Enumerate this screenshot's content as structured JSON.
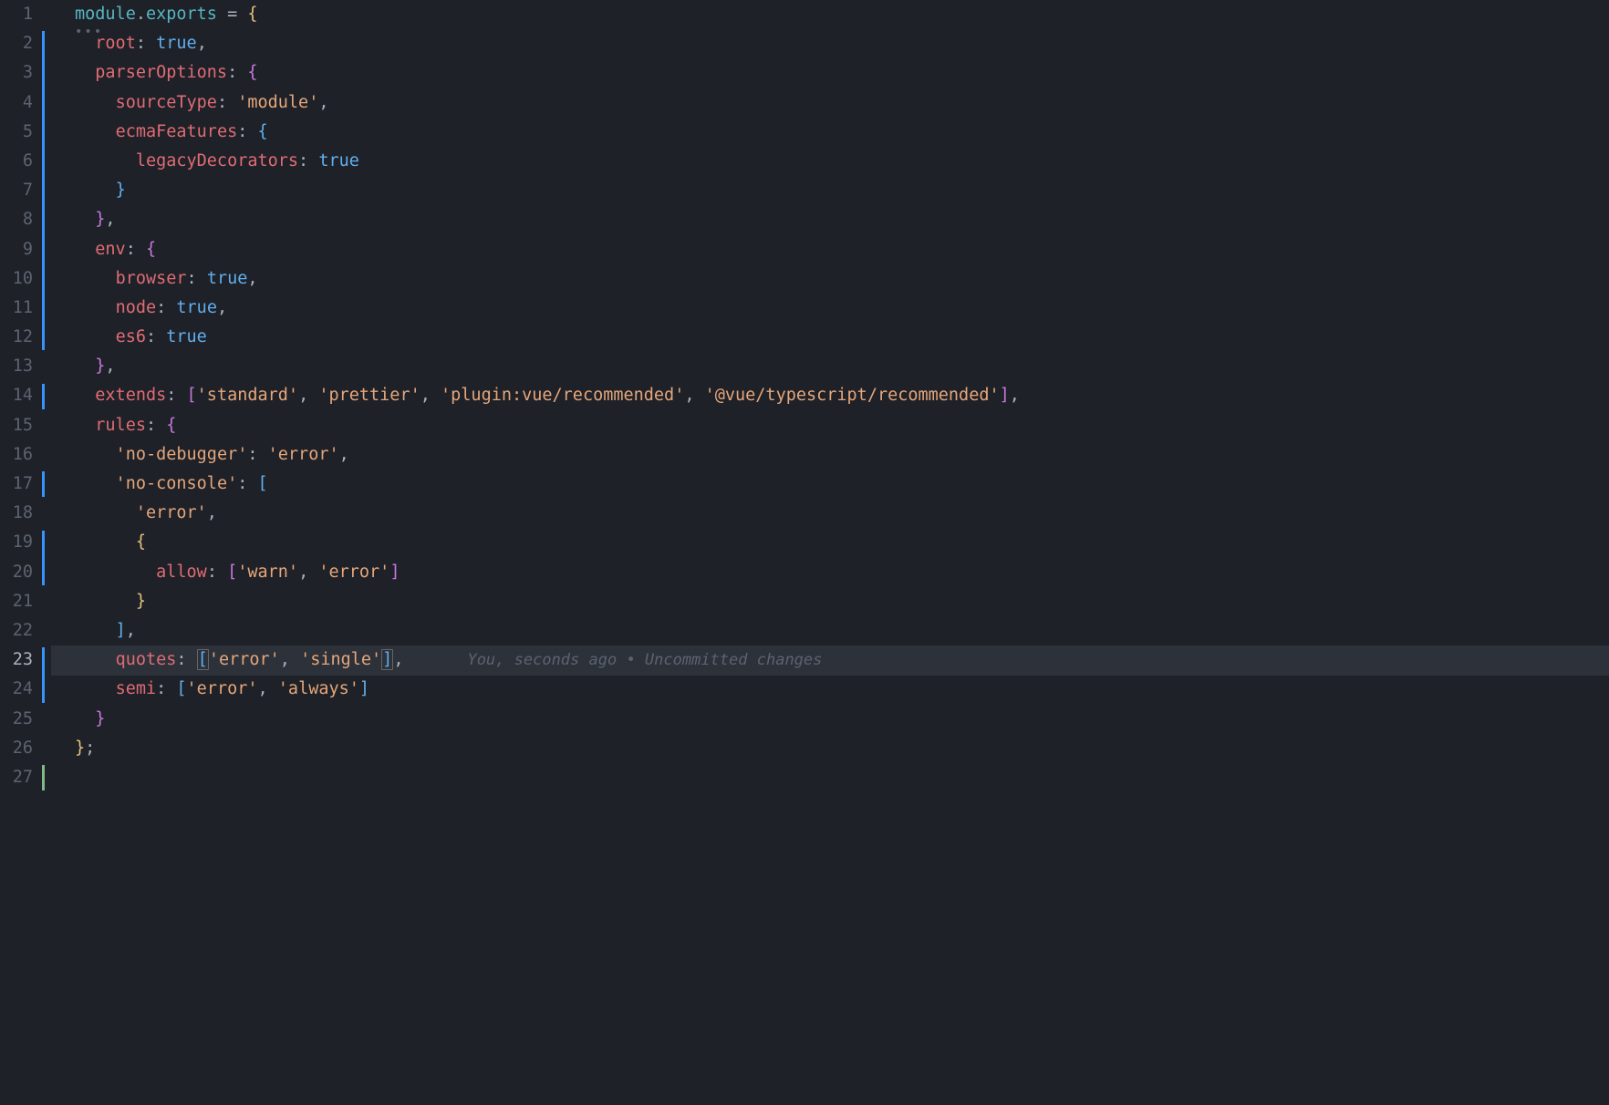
{
  "gitlens": "You, seconds ago • Uncommitted changes",
  "current_line": 23,
  "line_count": 27,
  "diff_bars": [
    {
      "from": 2,
      "to": 12,
      "color": "blue"
    },
    {
      "from": 14,
      "to": 14,
      "color": "blue"
    },
    {
      "from": 17,
      "to": 17,
      "color": "blue"
    },
    {
      "from": 19,
      "to": 20,
      "color": "blue"
    },
    {
      "from": 23,
      "to": 24,
      "color": "blue"
    },
    {
      "from": 27,
      "to": 27,
      "color": "green"
    }
  ],
  "tokens": {
    "module": "module",
    "dot": ".",
    "exports": "exports",
    "eq": " = ",
    "lbrace": "{",
    "rbrace": "}",
    "lbracket": "[",
    "rbracket": "]",
    "comma": ",",
    "colon": ": ",
    "semi": ";",
    "root": "root",
    "true": "true",
    "parserOptions": "parserOptions",
    "sourceType": "sourceType",
    "module_str": "'module'",
    "ecmaFeatures": "ecmaFeatures",
    "legacyDecorators": "legacyDecorators",
    "env": "env",
    "browser": "browser",
    "node": "node",
    "es6": "es6",
    "extends": "extends",
    "standard": "'standard'",
    "prettier": "'prettier'",
    "pluginvue": "'plugin:vue/recommended'",
    "vuets": "'@vue/typescript/recommended'",
    "rules": "rules",
    "nodebugger": "'no-debugger'",
    "error": "'error'",
    "noconsole": "'no-console'",
    "allow": "allow",
    "warn": "'warn'",
    "quotes": "quotes",
    "single": "'single'",
    "semi_key": "semi",
    "always": "'always'"
  }
}
